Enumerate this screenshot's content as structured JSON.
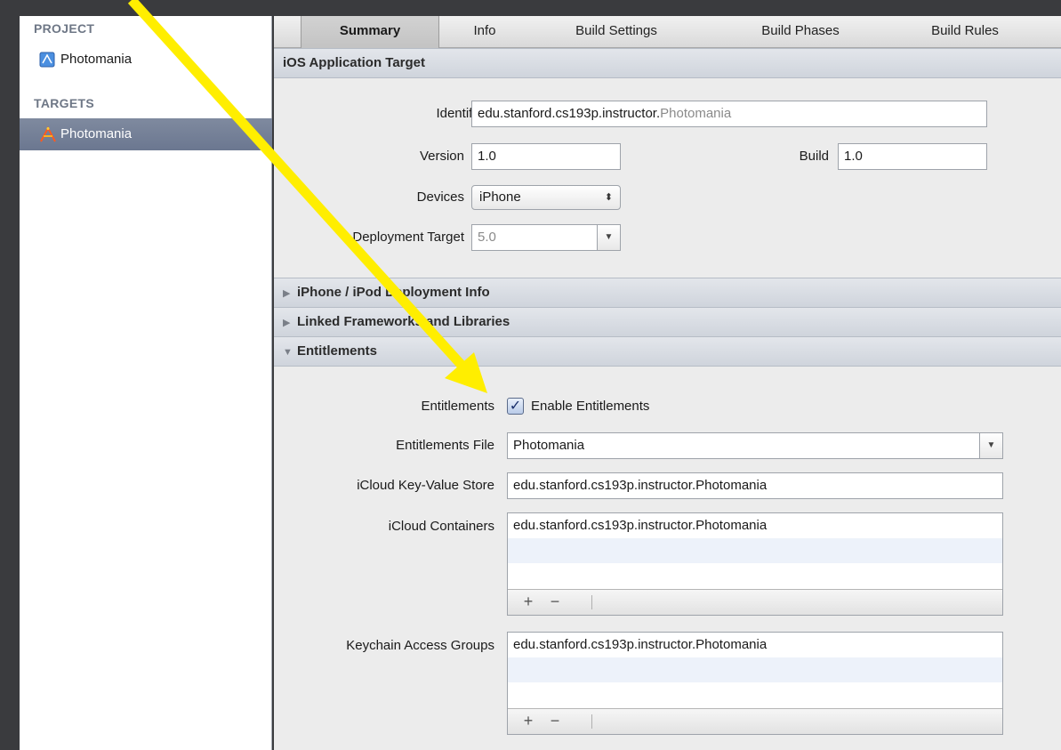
{
  "navigator": {
    "project_header": "PROJECT",
    "project_item": "Photomania",
    "targets_header": "TARGETS",
    "target_item": "Photomania"
  },
  "tabs": [
    "Summary",
    "Info",
    "Build Settings",
    "Build Phases",
    "Build Rules"
  ],
  "sections": {
    "ios_target": "iOS Application Target",
    "deployment_info": "iPhone / iPod Deployment Info",
    "linked_frameworks": "Linked Frameworks and Libraries",
    "entitlements": "Entitlements"
  },
  "target_form": {
    "identifier_label": "Identifier",
    "identifier_prefix": "edu.stanford.cs193p.instructor.",
    "identifier_suffix": "Photomania",
    "version_label": "Version",
    "version_value": "1.0",
    "build_label": "Build",
    "build_value": "1.0",
    "devices_label": "Devices",
    "devices_value": "iPhone",
    "deployment_label": "Deployment Target",
    "deployment_value": "5.0"
  },
  "entitlements_form": {
    "entitlements_label": "Entitlements",
    "enable_label": "Enable Entitlements",
    "enable_checked": true,
    "file_label": "Entitlements File",
    "file_value": "Photomania",
    "kv_store_label": "iCloud Key-Value Store",
    "kv_store_value": "edu.stanford.cs193p.instructor.Photomania",
    "containers_label": "iCloud Containers",
    "containers_items": [
      "edu.stanford.cs193p.instructor.Photomania"
    ],
    "keychain_label": "Keychain Access Groups",
    "keychain_items": [
      "edu.stanford.cs193p.instructor.Photomania"
    ],
    "add_glyph": "+",
    "remove_glyph": "−"
  },
  "colors": {
    "annotation_arrow": "#ffee00",
    "selection": "#6f7b93"
  },
  "icons": {
    "project": "xcode-project-icon",
    "target": "app-target-icon",
    "disclosure_closed": "triangle-right-icon",
    "disclosure_open": "triangle-down-icon"
  }
}
